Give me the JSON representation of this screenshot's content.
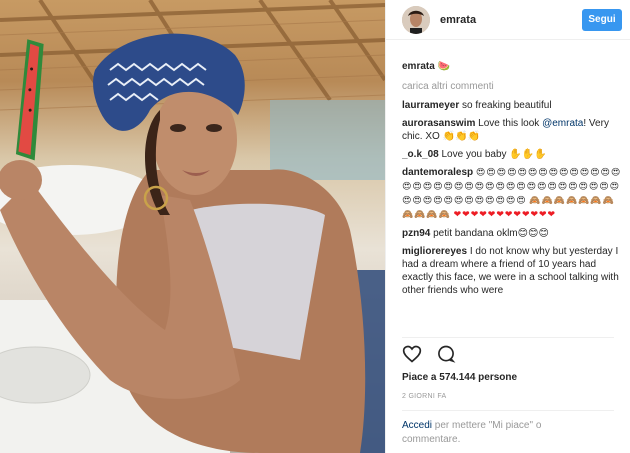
{
  "post": {
    "username": "emrata",
    "follow_label": "Segui",
    "caption_user": "emrata",
    "caption_text": "🍉",
    "load_more": "carica altri commenti",
    "comments": [
      {
        "user": "laurrameyer",
        "text": "so freaking beautiful"
      },
      {
        "user": "aurorasanswim",
        "text_before": "Love this look ",
        "mention": "@emrata",
        "text_after": "! Very chic. XO 👏👏👏"
      },
      {
        "user": "_o.k_08",
        "text": "Love you baby ✋✋✋"
      },
      {
        "user": "dantemoralesp",
        "emoji_line1": "😍😍😍😍😍😍😍😍😍😍😍😍😍😍😍😍😍😍😍😍😍😍😍😍😍😍😍😍😍😍😍😍😍😍😍😍😍😍😍😍😍😍😍😍😍😍😍",
        "emoji_line2": "🙈🙈🙈🙈🙈🙈🙈🙈🙈🙈🙈",
        "hearts": "❤❤❤❤❤❤❤❤❤❤❤❤"
      },
      {
        "user": "pzn94",
        "text": "petit bandana oklm😊😊😊"
      },
      {
        "user": "migliorereyes",
        "text": "I do not know why but yesterday I had a dream where a friend of 10 years had exactly this face, we were in a school talking with other friends who were"
      }
    ],
    "likes": "Piace a 574.144 persone",
    "time": "2 GIORNI FA",
    "add_comment_link": "Accedi",
    "add_comment_text": " per mettere \"Mi piace\" o commentare."
  },
  "icons": {
    "like": "heart-outline-icon",
    "comment": "comment-bubble-icon"
  },
  "colors": {
    "follow_button": "#3897f0",
    "link": "#003569",
    "muted": "#999999",
    "text": "#262626"
  }
}
